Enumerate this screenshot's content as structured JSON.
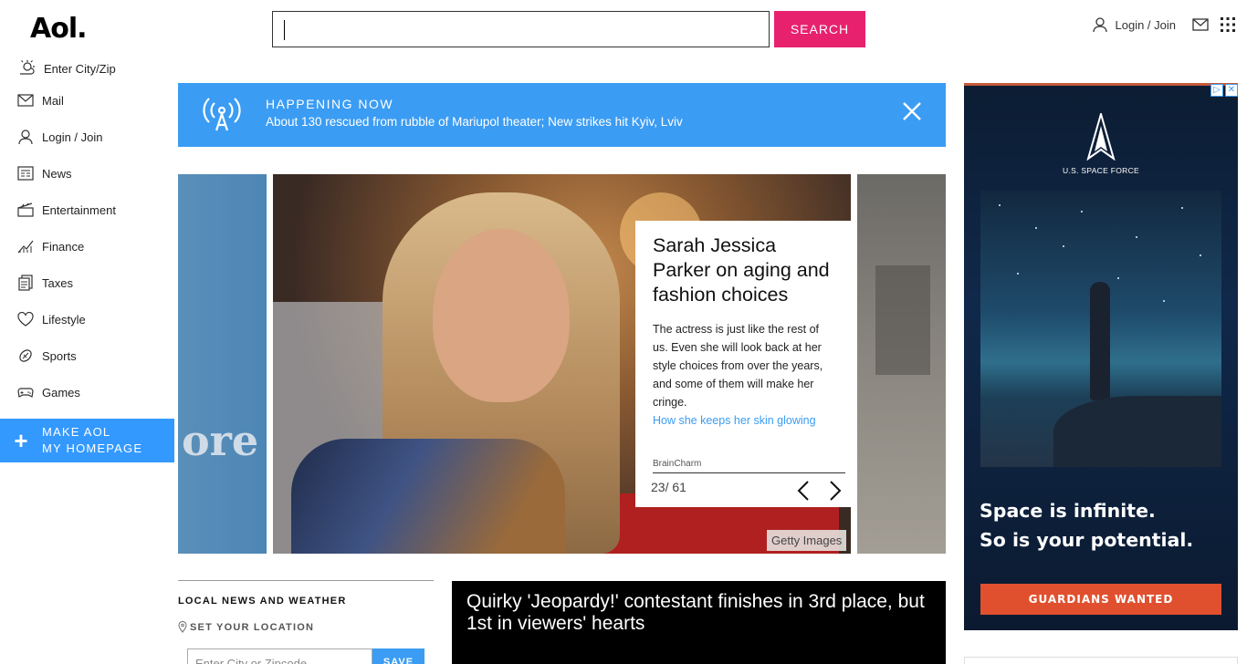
{
  "header": {
    "logo": "Aol.",
    "search_value": "",
    "search_button": "SEARCH",
    "login_label": "Login / Join"
  },
  "sidebar": {
    "items": [
      {
        "label": "Enter City/Zip",
        "icon": "weather-icon"
      },
      {
        "label": "Mail",
        "icon": "mail-icon"
      },
      {
        "label": "Login / Join",
        "icon": "user-icon"
      },
      {
        "label": "News",
        "icon": "news-icon"
      },
      {
        "label": "Entertainment",
        "icon": "clapper-icon"
      },
      {
        "label": "Finance",
        "icon": "chart-icon"
      },
      {
        "label": "Taxes",
        "icon": "document-icon"
      },
      {
        "label": "Lifestyle",
        "icon": "heart-icon"
      },
      {
        "label": "Sports",
        "icon": "ball-icon"
      },
      {
        "label": "Games",
        "icon": "gamepad-icon"
      }
    ],
    "make_home_line1": "MAKE AOL",
    "make_home_line2": "MY HOMEPAGE"
  },
  "happening": {
    "label": "HAPPENING NOW",
    "headline": "About 130 rescued from rubble of Mariupol theater; New strikes hit Kyiv, Lviv"
  },
  "carousel": {
    "left_slide_text": "ore",
    "title": "Sarah Jessica Parker on aging and fashion choices",
    "description": "The actress is just like the rest of us. Even she will look back at her style choices from over the years, and some of them will make her cringe.",
    "link": "How she keeps her skin glowing",
    "source": "BrainCharm",
    "counter": "23/ 61",
    "credit": "Getty Images"
  },
  "local": {
    "heading": "LOCAL NEWS AND WEATHER",
    "set_location": "SET YOUR LOCATION",
    "zip_placeholder": "Enter City or Zipcode",
    "save": "SAVE"
  },
  "video": {
    "title": "Quirky 'Jeopardy!' contestant finishes in 3rd place, but 1st in viewers' hearts"
  },
  "ad": {
    "brand": "U.S. SPACE FORCE",
    "line1": "Space is infinite.",
    "line2": "So is your potential.",
    "cta": "GUARDIANS WANTED"
  },
  "colors": {
    "accent_pink": "#e8216f",
    "accent_blue": "#3b9cf3",
    "ad_cta": "#e0502f"
  }
}
